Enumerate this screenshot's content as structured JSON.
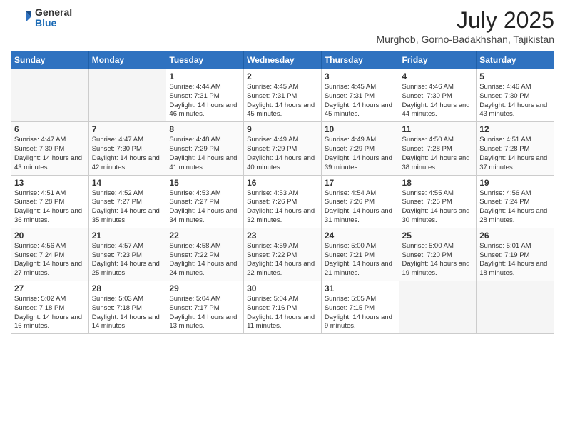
{
  "header": {
    "logo_general": "General",
    "logo_blue": "Blue",
    "month_year": "July 2025",
    "location": "Murghob, Gorno-Badakhshan, Tajikistan"
  },
  "days_of_week": [
    "Sunday",
    "Monday",
    "Tuesday",
    "Wednesday",
    "Thursday",
    "Friday",
    "Saturday"
  ],
  "weeks": [
    [
      {
        "day": "",
        "empty": true
      },
      {
        "day": "",
        "empty": true
      },
      {
        "day": "1",
        "sunrise": "4:44 AM",
        "sunset": "7:31 PM",
        "daylight": "14 hours and 46 minutes."
      },
      {
        "day": "2",
        "sunrise": "4:45 AM",
        "sunset": "7:31 PM",
        "daylight": "14 hours and 45 minutes."
      },
      {
        "day": "3",
        "sunrise": "4:45 AM",
        "sunset": "7:31 PM",
        "daylight": "14 hours and 45 minutes."
      },
      {
        "day": "4",
        "sunrise": "4:46 AM",
        "sunset": "7:30 PM",
        "daylight": "14 hours and 44 minutes."
      },
      {
        "day": "5",
        "sunrise": "4:46 AM",
        "sunset": "7:30 PM",
        "daylight": "14 hours and 43 minutes."
      }
    ],
    [
      {
        "day": "6",
        "sunrise": "4:47 AM",
        "sunset": "7:30 PM",
        "daylight": "14 hours and 43 minutes."
      },
      {
        "day": "7",
        "sunrise": "4:47 AM",
        "sunset": "7:30 PM",
        "daylight": "14 hours and 42 minutes."
      },
      {
        "day": "8",
        "sunrise": "4:48 AM",
        "sunset": "7:29 PM",
        "daylight": "14 hours and 41 minutes."
      },
      {
        "day": "9",
        "sunrise": "4:49 AM",
        "sunset": "7:29 PM",
        "daylight": "14 hours and 40 minutes."
      },
      {
        "day": "10",
        "sunrise": "4:49 AM",
        "sunset": "7:29 PM",
        "daylight": "14 hours and 39 minutes."
      },
      {
        "day": "11",
        "sunrise": "4:50 AM",
        "sunset": "7:28 PM",
        "daylight": "14 hours and 38 minutes."
      },
      {
        "day": "12",
        "sunrise": "4:51 AM",
        "sunset": "7:28 PM",
        "daylight": "14 hours and 37 minutes."
      }
    ],
    [
      {
        "day": "13",
        "sunrise": "4:51 AM",
        "sunset": "7:28 PM",
        "daylight": "14 hours and 36 minutes."
      },
      {
        "day": "14",
        "sunrise": "4:52 AM",
        "sunset": "7:27 PM",
        "daylight": "14 hours and 35 minutes."
      },
      {
        "day": "15",
        "sunrise": "4:53 AM",
        "sunset": "7:27 PM",
        "daylight": "14 hours and 34 minutes."
      },
      {
        "day": "16",
        "sunrise": "4:53 AM",
        "sunset": "7:26 PM",
        "daylight": "14 hours and 32 minutes."
      },
      {
        "day": "17",
        "sunrise": "4:54 AM",
        "sunset": "7:26 PM",
        "daylight": "14 hours and 31 minutes."
      },
      {
        "day": "18",
        "sunrise": "4:55 AM",
        "sunset": "7:25 PM",
        "daylight": "14 hours and 30 minutes."
      },
      {
        "day": "19",
        "sunrise": "4:56 AM",
        "sunset": "7:24 PM",
        "daylight": "14 hours and 28 minutes."
      }
    ],
    [
      {
        "day": "20",
        "sunrise": "4:56 AM",
        "sunset": "7:24 PM",
        "daylight": "14 hours and 27 minutes."
      },
      {
        "day": "21",
        "sunrise": "4:57 AM",
        "sunset": "7:23 PM",
        "daylight": "14 hours and 25 minutes."
      },
      {
        "day": "22",
        "sunrise": "4:58 AM",
        "sunset": "7:22 PM",
        "daylight": "14 hours and 24 minutes."
      },
      {
        "day": "23",
        "sunrise": "4:59 AM",
        "sunset": "7:22 PM",
        "daylight": "14 hours and 22 minutes."
      },
      {
        "day": "24",
        "sunrise": "5:00 AM",
        "sunset": "7:21 PM",
        "daylight": "14 hours and 21 minutes."
      },
      {
        "day": "25",
        "sunrise": "5:00 AM",
        "sunset": "7:20 PM",
        "daylight": "14 hours and 19 minutes."
      },
      {
        "day": "26",
        "sunrise": "5:01 AM",
        "sunset": "7:19 PM",
        "daylight": "14 hours and 18 minutes."
      }
    ],
    [
      {
        "day": "27",
        "sunrise": "5:02 AM",
        "sunset": "7:18 PM",
        "daylight": "14 hours and 16 minutes."
      },
      {
        "day": "28",
        "sunrise": "5:03 AM",
        "sunset": "7:18 PM",
        "daylight": "14 hours and 14 minutes."
      },
      {
        "day": "29",
        "sunrise": "5:04 AM",
        "sunset": "7:17 PM",
        "daylight": "14 hours and 13 minutes."
      },
      {
        "day": "30",
        "sunrise": "5:04 AM",
        "sunset": "7:16 PM",
        "daylight": "14 hours and 11 minutes."
      },
      {
        "day": "31",
        "sunrise": "5:05 AM",
        "sunset": "7:15 PM",
        "daylight": "14 hours and 9 minutes."
      },
      {
        "day": "",
        "empty": true
      },
      {
        "day": "",
        "empty": true
      }
    ]
  ]
}
